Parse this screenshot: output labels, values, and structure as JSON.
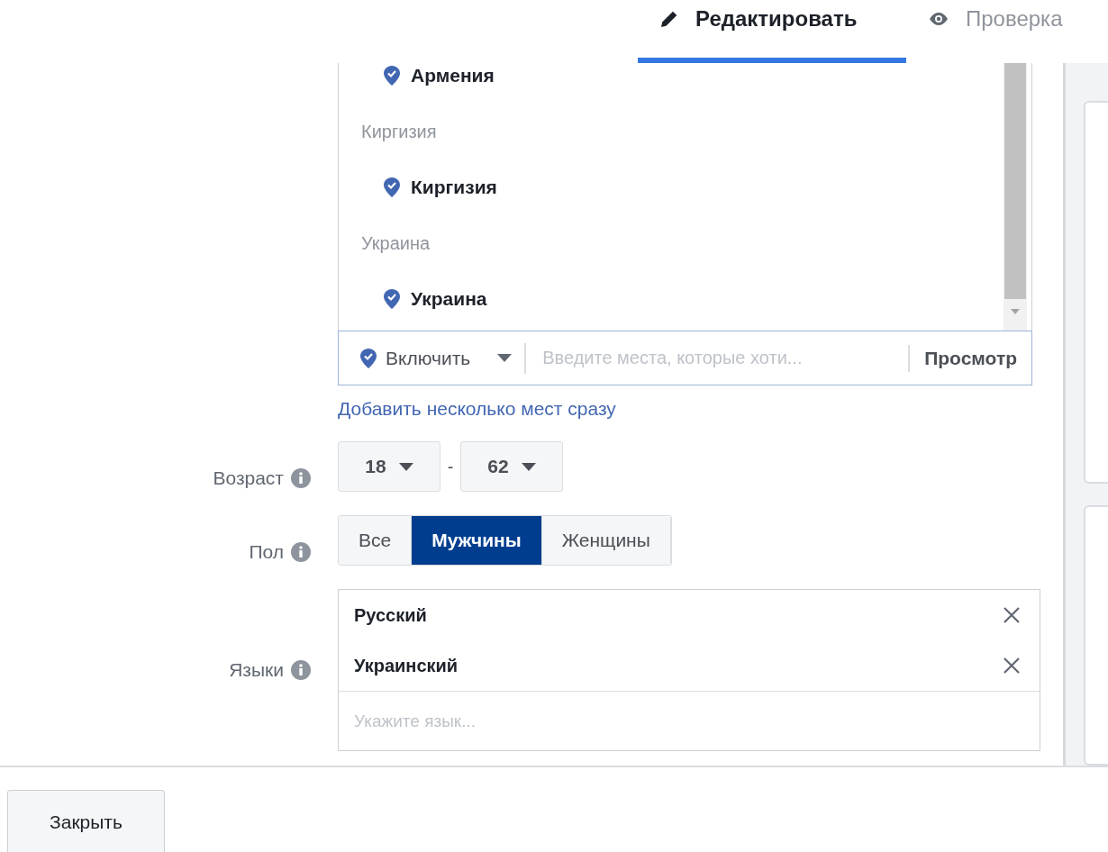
{
  "tabs": [
    {
      "label": "Редактировать",
      "selected": true
    },
    {
      "label": "Проверка",
      "selected": false
    }
  ],
  "locations": {
    "items": [
      {
        "kind": "place",
        "label": "Армения"
      },
      {
        "kind": "group",
        "label": "Киргизия"
      },
      {
        "kind": "place",
        "label": "Киргизия"
      },
      {
        "kind": "group",
        "label": "Украина"
      },
      {
        "kind": "place",
        "label": "Украина"
      }
    ],
    "mode": "Включить",
    "placeholder": "Введите места, которые хоти...",
    "browse": "Просмотр",
    "bulk_link": "Добавить несколько мест сразу"
  },
  "age": {
    "label": "Возраст",
    "from": "18",
    "separator": "-",
    "to": "62"
  },
  "gender": {
    "label": "Пол",
    "options": [
      {
        "label": "Все",
        "selected": false
      },
      {
        "label": "Мужчины",
        "selected": true
      },
      {
        "label": "Женщины",
        "selected": false
      }
    ]
  },
  "languages": {
    "label": "Языки",
    "items": [
      "Русский",
      "Украинский"
    ],
    "placeholder": "Укажите язык..."
  },
  "footer": {
    "close": "Закрыть"
  }
}
